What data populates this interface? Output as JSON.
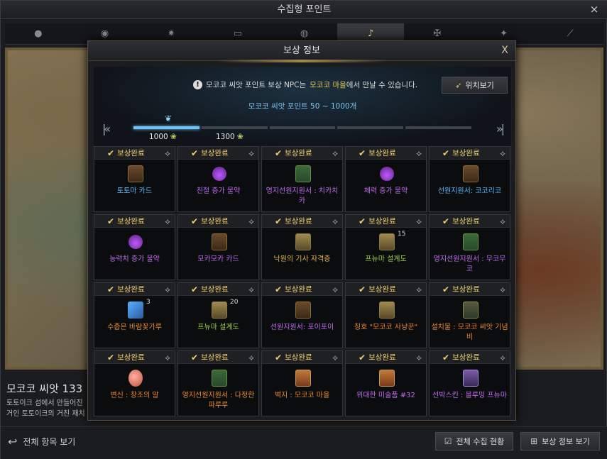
{
  "window": {
    "title": "수집형 포인트",
    "close_icon": "×",
    "dim_text": ""
  },
  "categories": [
    {
      "icon": "island-heart-icon"
    },
    {
      "icon": "giant-heart-icon"
    },
    {
      "icon": "star-icon"
    },
    {
      "icon": "art-icon"
    },
    {
      "icon": "omnium-icon"
    },
    {
      "icon": "mococo-seed-icon",
      "active": true
    },
    {
      "icon": "adventure-icon"
    },
    {
      "icon": "leaf-icon"
    },
    {
      "icon": "telescope-icon"
    }
  ],
  "collection": {
    "name": "모코코 씨앗 133",
    "desc_line1": "토토이크 섬에서 만들어진",
    "desc_line2": "거인 토토이크의 거친 재치"
  },
  "footer": {
    "view_all": "전체 항목 보기",
    "collection_status": "전체 수집 현황",
    "reward_info": "보상 정보 보기"
  },
  "modal": {
    "title": "보상 정보",
    "close_icon": "X",
    "notice_part1": "모코코 씨앗 포인트 보상 NPC는",
    "notice_highlight": "모코코 마을",
    "notice_part2": "에서 만날 수 있습니다.",
    "location_button": "위치보기",
    "range_text": "모코코 씨앗 포인트 50 ~ 1000개",
    "progress": {
      "segments_total": 5,
      "segments_filled": 1
    },
    "milestones": [
      {
        "value": "1000"
      },
      {
        "value": "1300"
      }
    ],
    "completed_label": "보상완료",
    "rewards": [
      {
        "name": "토토마 카드",
        "color": "blue",
        "icon": "card"
      },
      {
        "name": "친절 증가 물약",
        "color": "purple",
        "icon": "potion"
      },
      {
        "name": "영지선원지원서 : 치카치카",
        "color": "purple",
        "icon": "scroll"
      },
      {
        "name": "체력 증가 물약",
        "color": "purple",
        "icon": "potion"
      },
      {
        "name": "선원지원서: 코코리코",
        "color": "blue",
        "icon": "card"
      },
      {
        "name": "능력치 증가 물약",
        "color": "purple",
        "icon": "potion"
      },
      {
        "name": "모카모카 카드",
        "color": "purple",
        "icon": "card"
      },
      {
        "name": "낙원의 기사 자격증",
        "color": "gold",
        "icon": "map"
      },
      {
        "name": "프뉴마 설계도",
        "color": "green",
        "icon": "map",
        "qty": "15"
      },
      {
        "name": "영지선원지원서 : 무코무코",
        "color": "purple",
        "icon": "scroll"
      },
      {
        "name": "수줍은 바람꽃가루",
        "color": "orange",
        "icon": "powder",
        "qty": "3"
      },
      {
        "name": "프뉴마 설계도",
        "color": "green",
        "icon": "map",
        "qty": "20"
      },
      {
        "name": "선원지원서: 포이포이",
        "color": "purple",
        "icon": "card"
      },
      {
        "name": "칭호 \"모코코 사냥꾼\"",
        "color": "orange",
        "icon": "map"
      },
      {
        "name": "설치물 : 모코코 씨앗 기념비",
        "color": "orange",
        "icon": "statue"
      },
      {
        "name": "변신 : 창조의 알",
        "color": "orange",
        "icon": "egg"
      },
      {
        "name": "영지선원지원서 : 다정한 파루루",
        "color": "orange",
        "icon": "scroll"
      },
      {
        "name": "벽지 : 모코코 마을",
        "color": "orange",
        "icon": "rug"
      },
      {
        "name": "위대한 미술품 #32",
        "color": "purple",
        "icon": "rug"
      },
      {
        "name": "선박스킨 : 블루밍 프뉴마",
        "color": "purple",
        "icon": "ship"
      }
    ]
  }
}
